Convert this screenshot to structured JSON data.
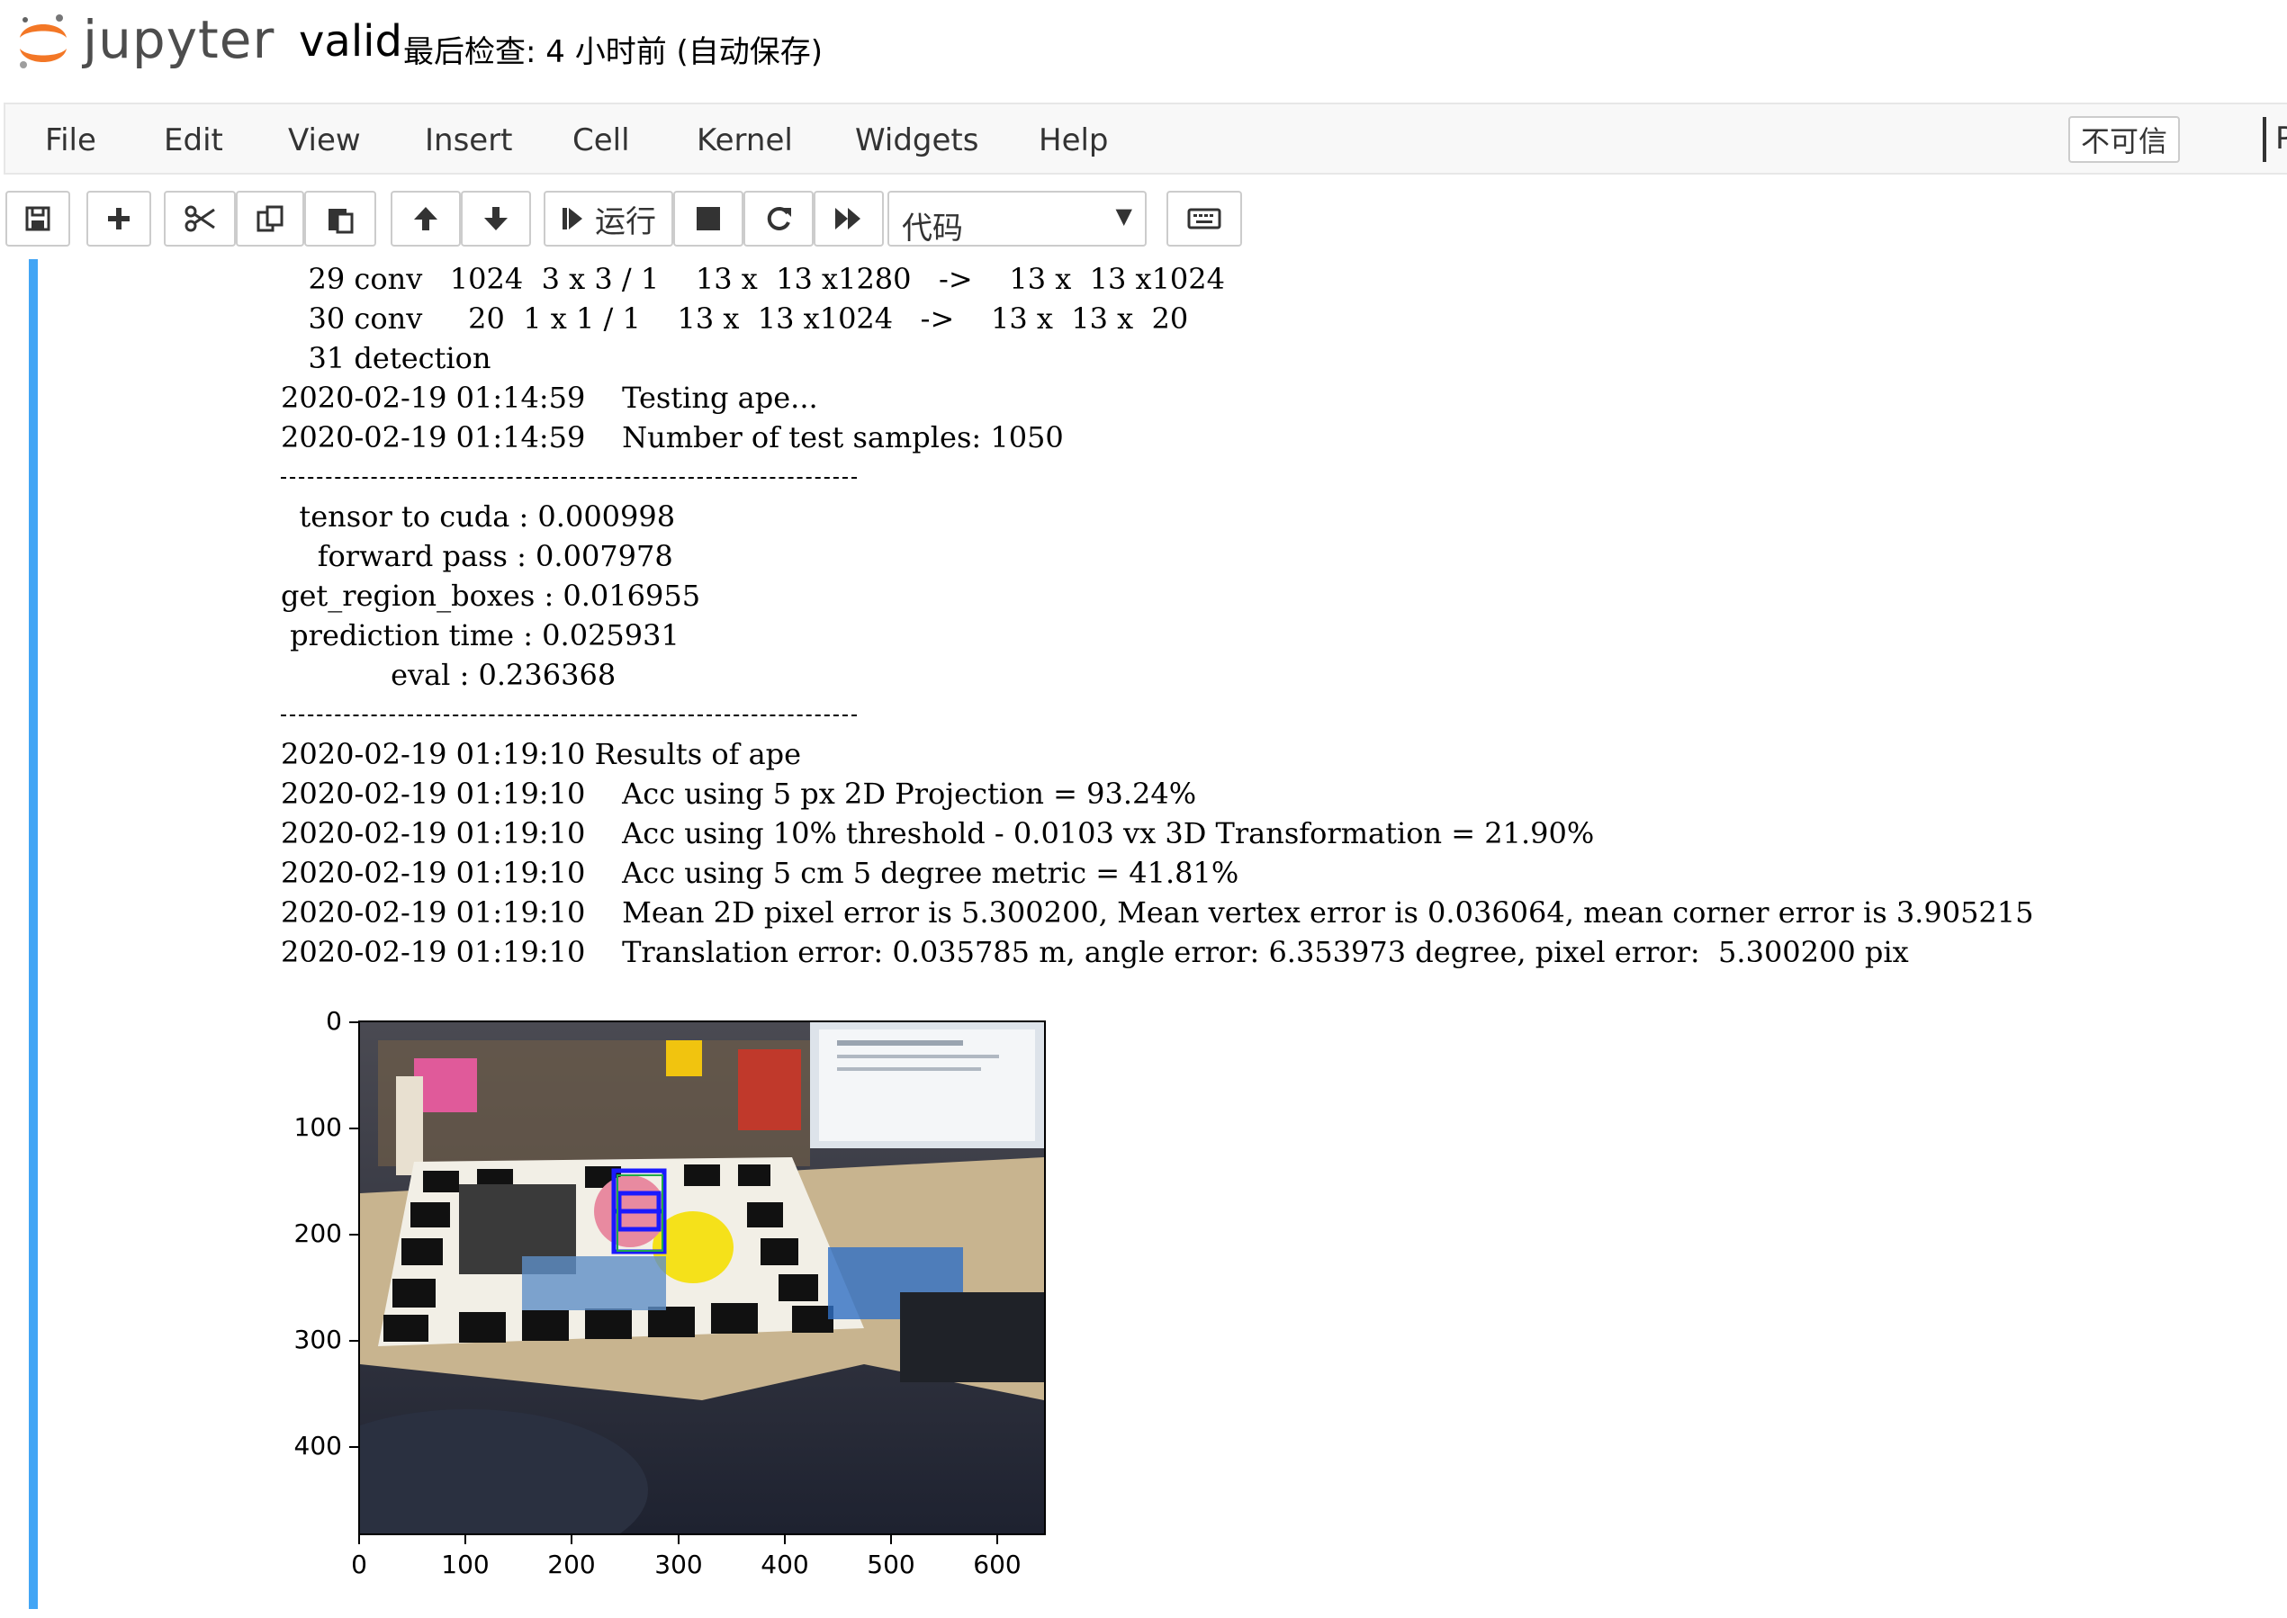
{
  "header": {
    "logo_text": "jupyter",
    "notebook_name": "valid",
    "checkpoint": "最后检查: 4 小时前  (自动保存)"
  },
  "menubar": {
    "items": [
      "File",
      "Edit",
      "View",
      "Insert",
      "Cell",
      "Kernel",
      "Widgets",
      "Help"
    ],
    "trust_label": "不可信",
    "kernel_partial": "P"
  },
  "toolbar": {
    "run_label": "运行",
    "cell_type": "代码",
    "icons": [
      "save-icon",
      "plus-icon",
      "scissors-icon",
      "copy-icon",
      "paste-icon",
      "arrow-up-icon",
      "arrow-down-icon",
      "step-forward-icon",
      "stop-icon",
      "refresh-icon",
      "fast-forward-icon",
      "keyboard-icon"
    ]
  },
  "output": {
    "lines_top": [
      "   29 conv   1024  3 x 3 / 1    13 x  13 x1280   ->    13 x  13 x1024",
      "   30 conv     20  1 x 1 / 1    13 x  13 x1024   ->    13 x  13 x  20",
      "   31 detection",
      "2020-02-19 01:14:59    Testing ape...",
      "2020-02-19 01:14:59    Number of test samples: 1050"
    ],
    "timing_lines": [
      "  tensor to cuda : 0.000998",
      "    forward pass : 0.007978",
      "get_region_boxes : 0.016955",
      " prediction time : 0.025931",
      "            eval : 0.236368"
    ],
    "result_lines": [
      "2020-02-19 01:19:10 Results of ape",
      "2020-02-19 01:19:10    Acc using 5 px 2D Projection = 93.24%",
      "2020-02-19 01:19:10    Acc using 10% threshold - 0.0103 vx 3D Transformation = 21.90%",
      "2020-02-19 01:19:10    Acc using 5 cm 5 degree metric = 41.81%",
      "2020-02-19 01:19:10    Mean 2D pixel error is 5.300200, Mean vertex error is 0.036064, mean corner error is 3.905215",
      "2020-02-19 01:19:10    Translation error: 0.035785 m, angle error: 6.353973 degree, pixel error:  5.300200 pix"
    ]
  },
  "figure": {
    "y_ticks": [
      "0",
      "100",
      "200",
      "300",
      "400"
    ],
    "x_ticks": [
      "0",
      "100",
      "200",
      "300",
      "400",
      "500",
      "600"
    ],
    "box_color": "#1a1aff",
    "accent_color": "#42a5f5"
  }
}
